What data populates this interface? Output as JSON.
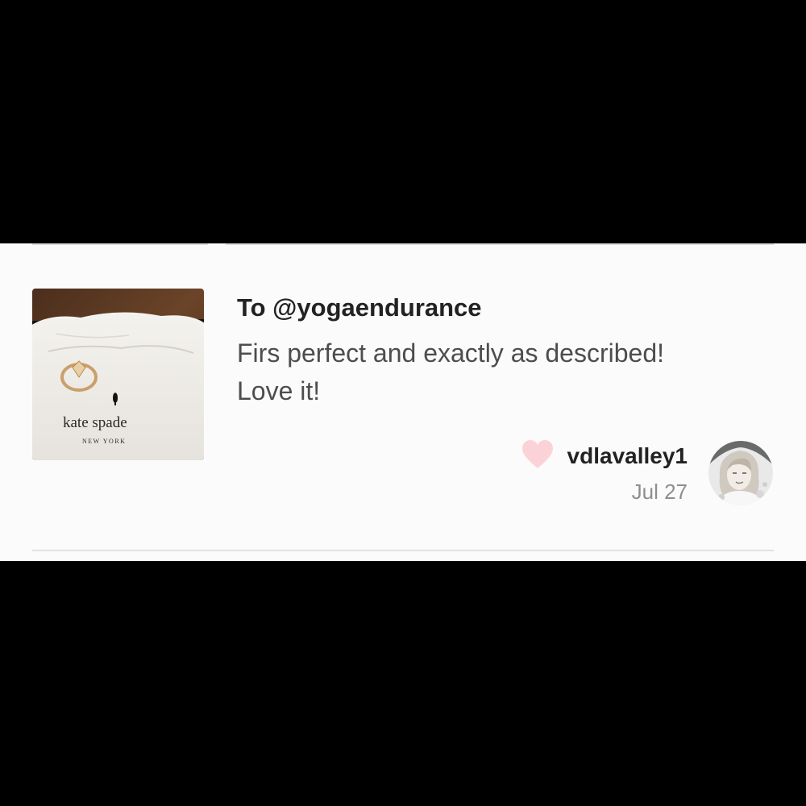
{
  "review": {
    "recipient": "To @yogaendurance",
    "comment_line1": "Firs perfect and exactly as described!",
    "comment_line2": "Love it!",
    "username": "vdlavalley1",
    "date": "Jul 27",
    "thumbnail": {
      "subject": "product-photo-ring-on-pouch",
      "brand_text": "kate spade",
      "brand_subtext": "NEW YORK"
    },
    "like_icon": "heart-icon"
  },
  "colors": {
    "background": "#000000",
    "card": "#fcfbfc",
    "heart": "#fbd3d6",
    "text_primary": "#222222",
    "text_secondary": "#4d4d4d",
    "text_muted": "#8e8e8e"
  }
}
